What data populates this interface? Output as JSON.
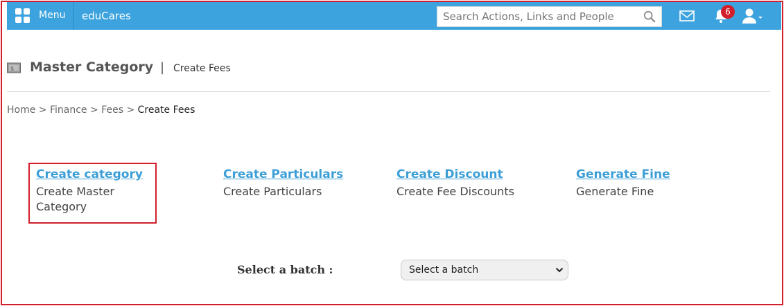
{
  "topbar": {
    "menu_label": "Menu",
    "brand": "eduCares",
    "search_placeholder": "Search Actions, Links and People",
    "notification_count": "6",
    "color": "#3ca3de"
  },
  "header": {
    "title": "Master Category",
    "separator": "|",
    "subtitle": "Create Fees"
  },
  "breadcrumb": {
    "items": [
      "Home",
      "Finance",
      "Fees",
      "Create Fees"
    ],
    "separator": ">"
  },
  "options": [
    {
      "link": "Create category",
      "description": "Create Master Category"
    },
    {
      "link": "Create Particulars",
      "description": "Create Particulars"
    },
    {
      "link": "Create Discount",
      "description": "Create Fee Discounts"
    },
    {
      "link": "Generate Fine",
      "description": "Generate Fine"
    }
  ],
  "batch": {
    "label": "Select a batch :",
    "selected": "Select a batch"
  },
  "colors": {
    "accent": "#3ca3de",
    "link": "#3b9ed6",
    "highlight": "#d21f2b"
  },
  "icons": [
    "grid-icon",
    "search-icon",
    "mail-icon",
    "bell-icon",
    "user-icon",
    "chevron-down-icon",
    "money-icon"
  ]
}
